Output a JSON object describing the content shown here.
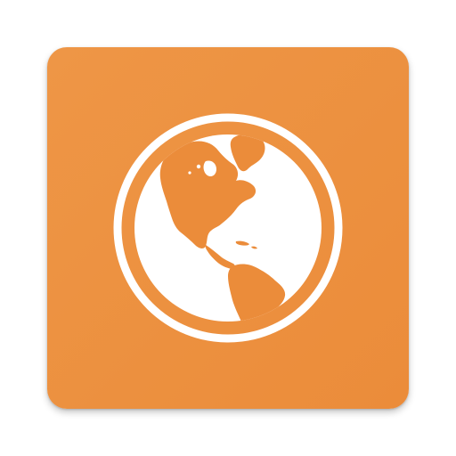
{
  "app_icon": {
    "icon": "globe-americas-icon",
    "colors": {
      "tile": "#EB8C3A",
      "tile_highlight": "#EE9646",
      "glyph": "#FFFFFF"
    }
  }
}
